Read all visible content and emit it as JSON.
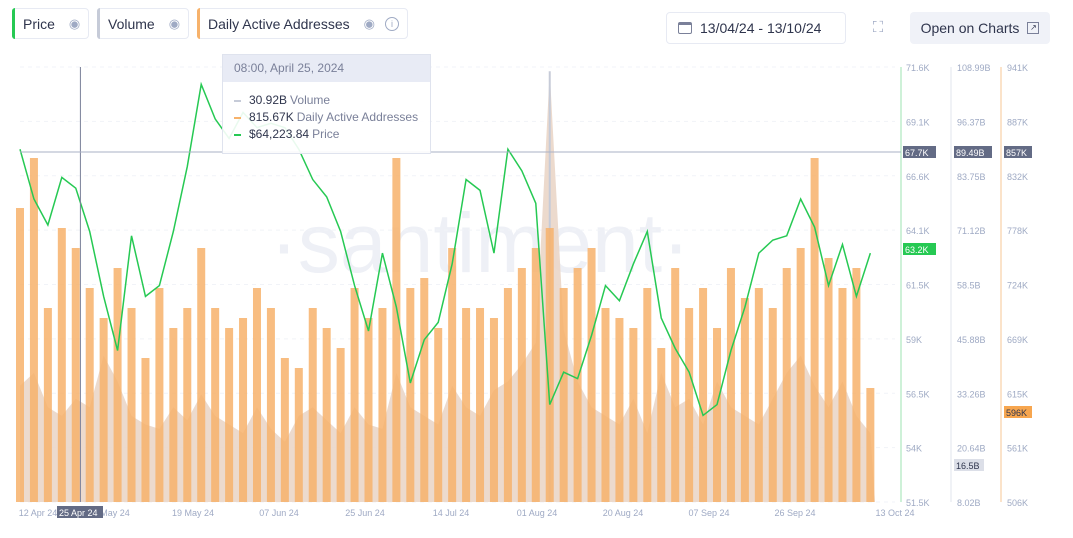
{
  "legend": [
    {
      "label": "Price",
      "color": "#26c953",
      "icon": "eye-icon"
    },
    {
      "label": "Volume",
      "color": "#c6cbd8",
      "icon": "eye-icon"
    },
    {
      "label": "Daily Active Addresses",
      "color": "#f7b26b",
      "icon": "eye-icon",
      "info_icon": "info-icon"
    }
  ],
  "toolbar": {
    "date_range": "13/04/24 - 13/10/24",
    "open_label": "Open on Charts"
  },
  "watermark": "·santiment·",
  "tooltip": {
    "title": "08:00, April 25, 2024",
    "rows": [
      {
        "value": "30.92B",
        "name": "Volume",
        "color": "#c6cbd8"
      },
      {
        "value": "815.67K",
        "name": "Daily Active Addresses",
        "color": "#f7b26b"
      },
      {
        "value": "$64,223.84",
        "name": "Price",
        "color": "#26c953"
      }
    ]
  },
  "crosshair": {
    "date_label": "25 Apr 24",
    "price_label": "67.7K",
    "volume_label": "89.49B",
    "daa_label": "857K"
  },
  "last_values": {
    "price": "63.2K",
    "volume": "16.5B",
    "daa": "596K"
  },
  "chart_data": {
    "type": "line+bar",
    "x_ticks": [
      "12 Apr 24",
      "May 24",
      "19 May 24",
      "07 Jun 24",
      "25 Jun 24",
      "14 Jul 24",
      "01 Aug 24",
      "20 Aug 24",
      "07 Sep 24",
      "26 Sep 24",
      "13 Oct 24"
    ],
    "xlim": [
      "2024-04-12",
      "2024-10-13"
    ],
    "axes": {
      "price": {
        "ticks": [
          "71.6K",
          "69.1K",
          "66.6K",
          "64.1K",
          "61.5K",
          "59K",
          "56.5K",
          "54K",
          "51.5K"
        ],
        "range_k": [
          51.5,
          71.6
        ],
        "color": "#26c953"
      },
      "volume": {
        "ticks": [
          "108.99B",
          "96.37B",
          "83.75B",
          "71.12B",
          "58.5B",
          "45.88B",
          "33.26B",
          "20.64B",
          "8.02B"
        ],
        "range_b": [
          8.02,
          108.99
        ],
        "color": "#c6cbd8"
      },
      "daa": {
        "ticks": [
          "941K",
          "887K",
          "832K",
          "778K",
          "724K",
          "669K",
          "615K",
          "561K",
          "506K"
        ],
        "range_k": [
          506,
          941
        ],
        "color": "#f7b26b"
      }
    },
    "dates": [
      "2024-04-12",
      "2024-04-15",
      "2024-04-18",
      "2024-04-21",
      "2024-04-24",
      "2024-04-27",
      "2024-04-30",
      "2024-05-03",
      "2024-05-06",
      "2024-05-09",
      "2024-05-12",
      "2024-05-15",
      "2024-05-18",
      "2024-05-21",
      "2024-05-24",
      "2024-05-27",
      "2024-05-30",
      "2024-06-02",
      "2024-06-05",
      "2024-06-08",
      "2024-06-11",
      "2024-06-14",
      "2024-06-17",
      "2024-06-20",
      "2024-06-23",
      "2024-06-26",
      "2024-06-29",
      "2024-07-02",
      "2024-07-05",
      "2024-07-08",
      "2024-07-11",
      "2024-07-14",
      "2024-07-17",
      "2024-07-20",
      "2024-07-23",
      "2024-07-26",
      "2024-07-29",
      "2024-08-01",
      "2024-08-04",
      "2024-08-07",
      "2024-08-10",
      "2024-08-13",
      "2024-08-16",
      "2024-08-19",
      "2024-08-22",
      "2024-08-25",
      "2024-08-28",
      "2024-08-31",
      "2024-09-03",
      "2024-09-06",
      "2024-09-09",
      "2024-09-12",
      "2024-09-15",
      "2024-09-18",
      "2024-09-21",
      "2024-09-24",
      "2024-09-27",
      "2024-09-30",
      "2024-10-03",
      "2024-10-06",
      "2024-10-09",
      "2024-10-12"
    ],
    "series": [
      {
        "name": "Price",
        "unit": "K USD",
        "values": [
          67.8,
          65.5,
          64.3,
          66.5,
          66,
          64,
          61,
          58.5,
          63.8,
          61,
          61.5,
          64,
          67,
          70.8,
          69.2,
          68.3,
          69.5,
          68.8,
          69,
          68.8,
          67.8,
          66.4,
          65.6,
          64,
          61.5,
          59.4,
          63,
          60.5,
          57,
          59,
          59.8,
          62.5,
          66.4,
          65.9,
          63,
          67.8,
          66.8,
          65.3,
          56,
          57.5,
          57.2,
          59.2,
          61.5,
          60.8,
          62.5,
          64,
          60,
          58.6,
          57.5,
          55.5,
          56,
          58.5,
          60.5,
          63,
          63.6,
          63.8,
          65.5,
          64.2,
          61.5,
          63.4,
          61,
          63
        ]
      },
      {
        "name": "Volume",
        "unit": "B",
        "values": [
          35,
          38,
          30,
          28,
          32,
          30,
          42,
          36,
          28,
          26,
          25,
          30,
          27,
          33,
          28,
          26,
          24,
          30,
          25,
          22,
          28,
          30,
          27,
          24,
          30,
          26,
          25,
          38,
          30,
          28,
          26,
          35,
          30,
          28,
          34,
          36,
          40,
          45,
          108,
          48,
          36,
          30,
          28,
          26,
          32,
          24,
          38,
          30,
          32,
          26,
          36,
          30,
          28,
          26,
          32,
          38,
          42,
          35,
          30,
          36,
          28,
          24
        ]
      },
      {
        "name": "Daily Active Addresses",
        "unit": "K",
        "values": [
          800,
          850,
          700,
          780,
          760,
          720,
          690,
          740,
          700,
          650,
          720,
          680,
          700,
          760,
          700,
          680,
          690,
          720,
          700,
          650,
          640,
          700,
          680,
          660,
          720,
          690,
          700,
          850,
          720,
          730,
          680,
          760,
          700,
          700,
          690,
          720,
          740,
          760,
          780,
          720,
          740,
          760,
          700,
          690,
          680,
          720,
          660,
          740,
          700,
          720,
          680,
          740,
          710,
          720,
          700,
          740,
          760,
          850,
          750,
          720,
          740,
          620
        ]
      }
    ],
    "grid": true
  }
}
